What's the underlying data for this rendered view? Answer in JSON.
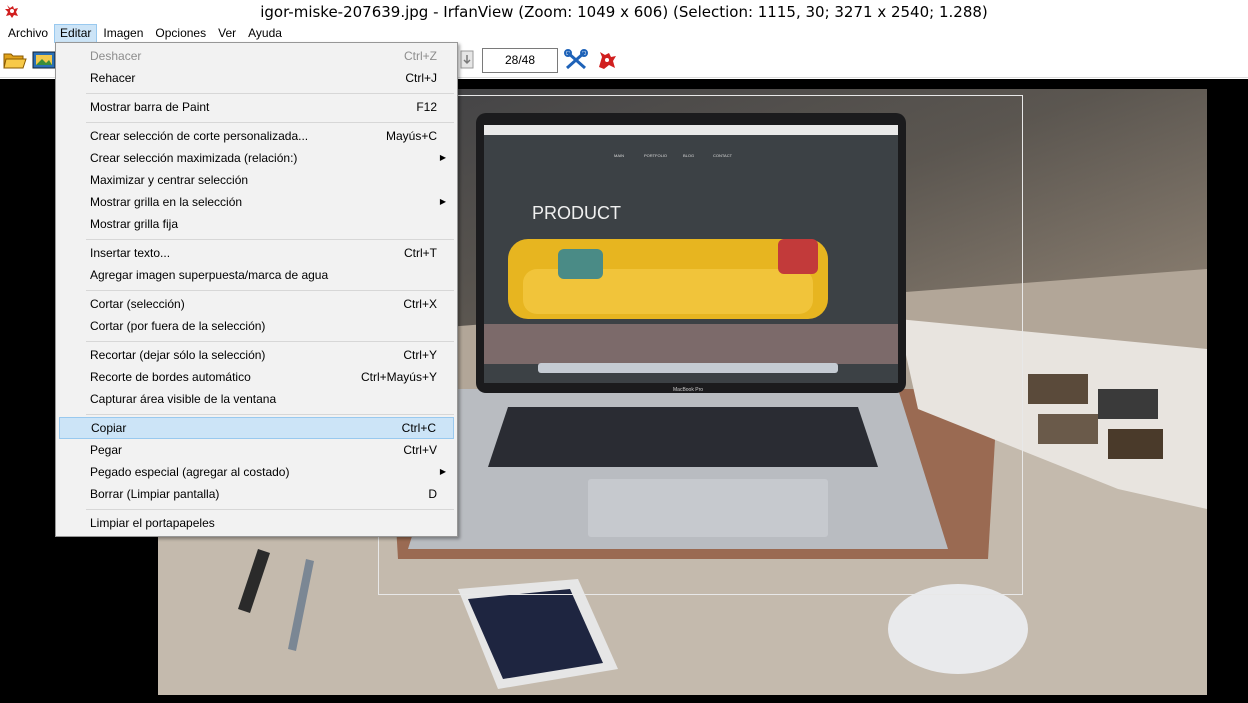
{
  "window": {
    "title": "igor-miske-207639.jpg - IrfanView (Zoom: 1049 x 606) (Selection: 1115, 30; 3271 x 2540; 1.288)",
    "app_icon": "irfanview-red-cat-icon"
  },
  "menubar": {
    "items": [
      "Archivo",
      "Editar",
      "Imagen",
      "Opciones",
      "Ver",
      "Ayuda"
    ],
    "active": "Editar"
  },
  "toolbar": {
    "page_counter": "28/48",
    "icons": [
      "open-folder-icon",
      "thumbnails-icon",
      "next-page-icon",
      "properties-tools-icon",
      "irfanview-cat-icon"
    ]
  },
  "edit_menu": {
    "items": [
      {
        "label": "Deshacer",
        "shortcut": "Ctrl+Z",
        "disabled": true
      },
      {
        "label": "Rehacer",
        "shortcut": "Ctrl+J"
      },
      {
        "label": "Mostrar barra de Paint",
        "shortcut": "F12"
      },
      {
        "label": "Crear selección de corte personalizada...",
        "shortcut": "Mayús+C"
      },
      {
        "label": "Crear selección maximizada (relación:)",
        "shortcut": "",
        "submenu": true
      },
      {
        "label": "Maximizar y centrar selección",
        "shortcut": ""
      },
      {
        "label": "Mostrar grilla en la selección",
        "shortcut": "",
        "submenu": true
      },
      {
        "label": "Mostrar grilla fija",
        "shortcut": ""
      },
      {
        "label": "Insertar texto...",
        "shortcut": "Ctrl+T"
      },
      {
        "label": "Agregar imagen superpuesta/marca de agua",
        "shortcut": ""
      },
      {
        "label": "Cortar (selección)",
        "shortcut": "Ctrl+X"
      },
      {
        "label": "Cortar (por fuera de la selección)",
        "shortcut": ""
      },
      {
        "label": "Recortar (dejar sólo la selección)",
        "shortcut": "Ctrl+Y"
      },
      {
        "label": "Recorte de bordes automático",
        "shortcut": "Ctrl+Mayús+Y"
      },
      {
        "label": "Capturar área visible de la ventana",
        "shortcut": ""
      },
      {
        "label": "Copiar",
        "shortcut": "Ctrl+C",
        "highlighted": true
      },
      {
        "label": "Pegar",
        "shortcut": "Ctrl+V"
      },
      {
        "label": "Pegado especial (agregar al costado)",
        "shortcut": "",
        "submenu": true
      },
      {
        "label": "Borrar (Limpiar pantalla)",
        "shortcut": "D"
      },
      {
        "label": "Limpiar el portapapeles",
        "shortcut": ""
      }
    ]
  },
  "image": {
    "screen_heading": "PRODUCT",
    "nav_items": [
      "MAIN",
      "PORTFOLIO",
      "BLOG",
      "CONTACT"
    ],
    "laptop_label": "MacBook Pro"
  }
}
